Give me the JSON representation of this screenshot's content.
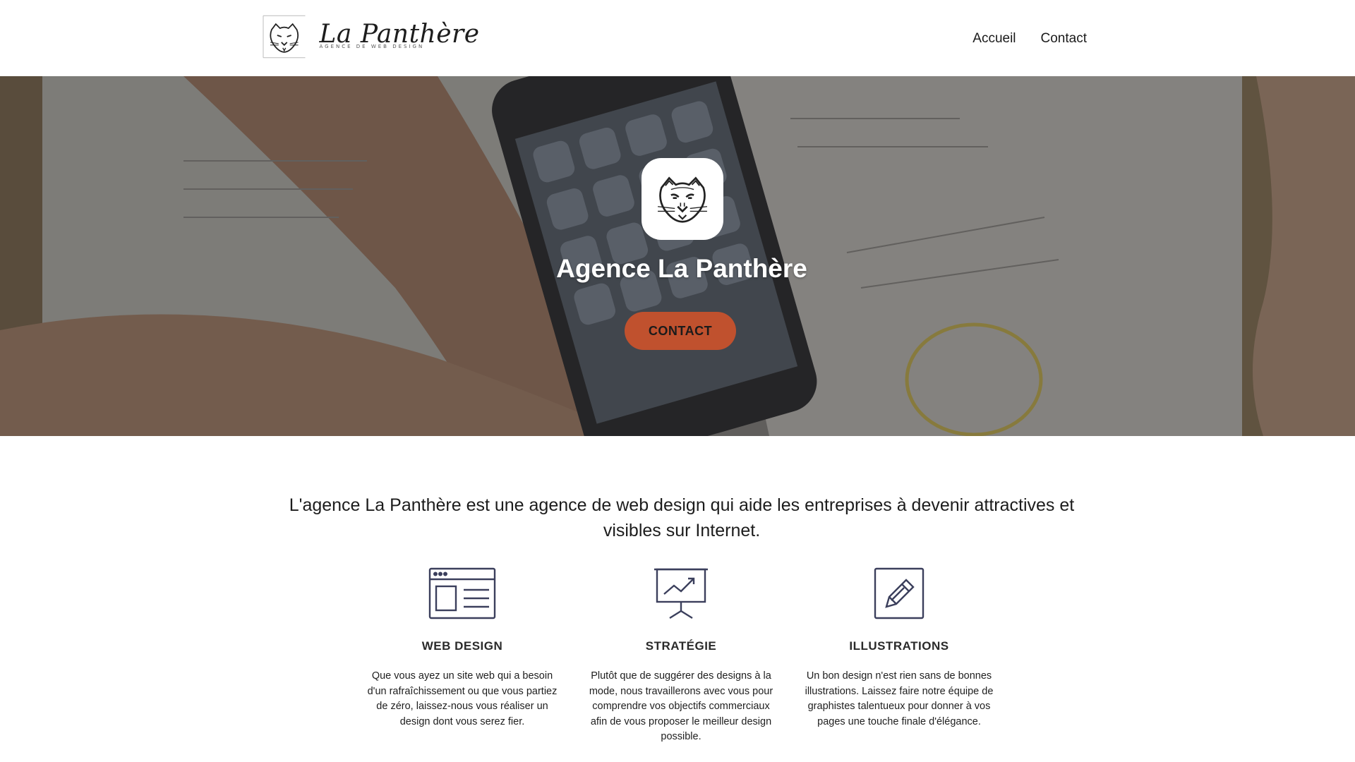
{
  "header": {
    "logo": {
      "title": "La Panthère",
      "tagline": "AGENCE DE WEB DESIGN"
    },
    "nav": [
      {
        "label": "Accueil"
      },
      {
        "label": "Contact"
      }
    ]
  },
  "hero": {
    "title": "Agence La Panthère",
    "button_label": "CONTACT",
    "button_color": "#c0512e"
  },
  "intro": {
    "text": "L'agence La Panthère est une agence de web design qui aide les entreprises à devenir attractives et visibles sur Internet."
  },
  "services": [
    {
      "icon": "web-design-icon",
      "title": "WEB DESIGN",
      "text": "Que vous ayez un site web qui a besoin d'un rafraîchissement ou que vous partiez de zéro, laissez-nous vous réaliser un design dont vous serez fier."
    },
    {
      "icon": "strategy-chart-icon",
      "title": "STRATÉGIE",
      "text": "Plutôt que de suggérer des designs à la mode, nous travaillerons avec vous pour comprendre vos objectifs commerciaux afin de vous proposer le meilleur design possible."
    },
    {
      "icon": "pencil-icon",
      "title": "ILLUSTRATIONS",
      "text": "Un bon design n'est rien sans de bonnes illustrations. Laissez faire notre équipe de graphistes talentueux pour donner à vos pages une touche finale d'élégance."
    }
  ],
  "colors": {
    "accent": "#c0512e",
    "icon_stroke": "#3b3f5c"
  }
}
